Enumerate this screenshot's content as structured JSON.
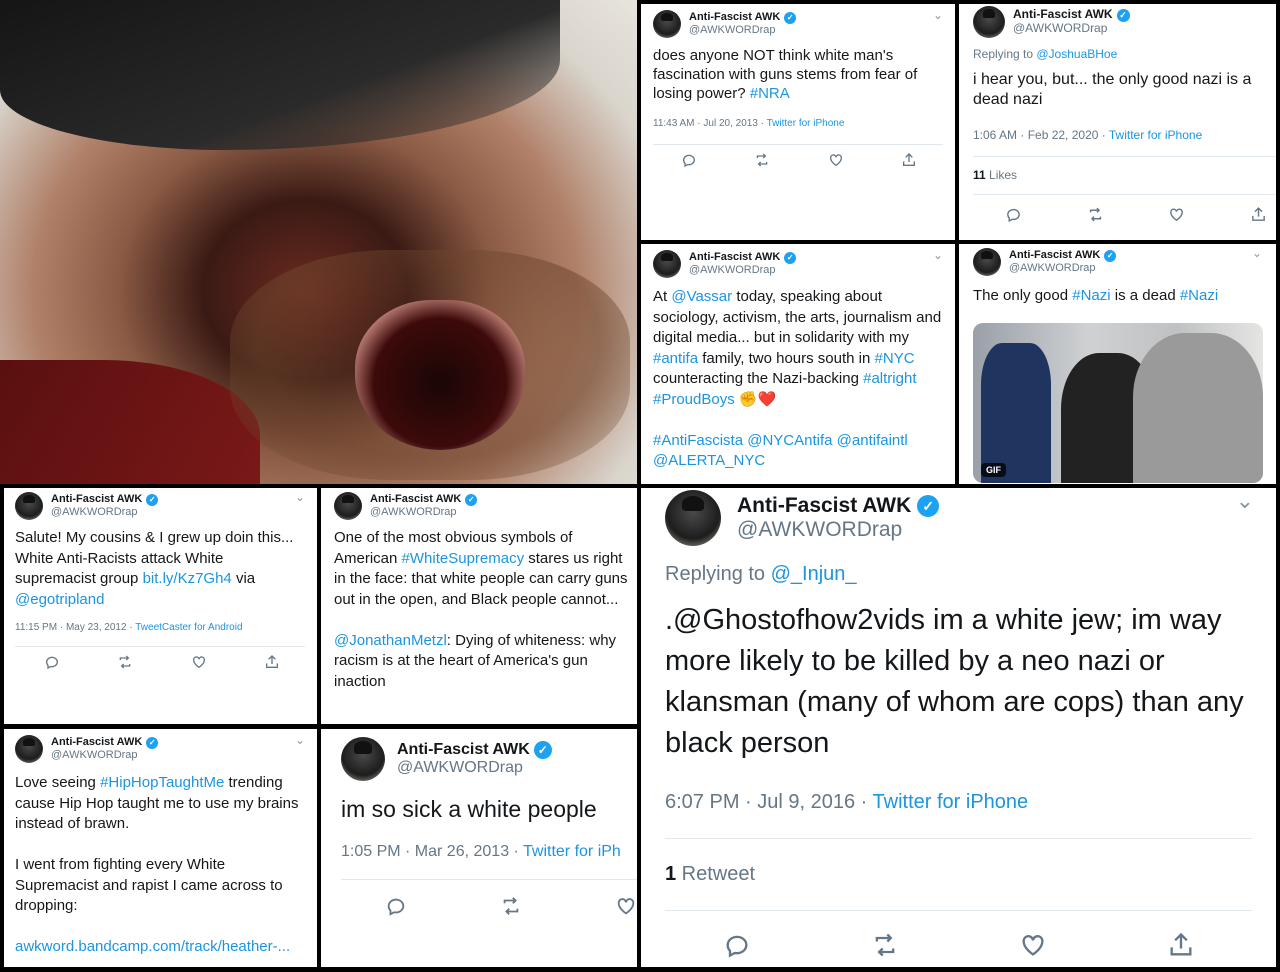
{
  "account": {
    "name": "Anti-Fascist AWK",
    "handle": "@AWKWORDrap"
  },
  "tweets": {
    "t1": {
      "text_parts": [
        "does anyone NOT think white man's fascination with guns stems from fear of losing power? ",
        "#NRA"
      ],
      "time": "11:43 AM · Jul 20, 2013 · ",
      "source": "Twitter for iPhone"
    },
    "t2": {
      "reply_label": "Replying to ",
      "reply_to": "@JoshuaBHoe",
      "text": "i hear you, but... the only good nazi is a dead nazi",
      "time": "1:06 AM · Feb 22, 2020 · ",
      "source": "Twitter for iPhone",
      "likes_count": "11",
      "likes_label": " Likes"
    },
    "t3": {
      "p1": [
        "At ",
        "@Vassar",
        " today, speaking about sociology, activism, the arts, journalism and digital media... but in solidarity with my ",
        "#antifa",
        " family, two hours south in ",
        "#NYC",
        " counteracting the Nazi-backing ",
        "#altright",
        " ",
        "#ProudBoys",
        " ✊❤️"
      ],
      "p2": [
        "#AntiFascista",
        " ",
        "@NYCAntifa",
        " ",
        "@antifaintl",
        " ",
        "@ALERTA_NYC"
      ]
    },
    "t4": {
      "text_parts": [
        "The only good ",
        "#Nazi",
        " is a dead ",
        "#Nazi"
      ],
      "gif_label": "GIF"
    },
    "t5": {
      "text_parts": [
        "Salute! My cousins & I grew up doin this... White Anti-Racists attack White supremacist group ",
        "bit.ly/Kz7Gh4",
        " via ",
        "@egotripland"
      ],
      "time": "11:15 PM · May 23, 2012 · ",
      "source": "TweetCaster for Android"
    },
    "t6": {
      "p1": [
        "One of the most obvious symbols of American ",
        "#WhiteSupremacy",
        " stares us right in the face: that white people can carry guns out in the open, and Black people cannot..."
      ],
      "p2": [
        "@JonathanMetzl",
        ": Dying of whiteness: why racism is at the heart of America's gun inaction"
      ]
    },
    "t7": {
      "p1": [
        "Love seeing ",
        "#HipHopTaughtMe",
        " trending cause Hip Hop taught me to use my brains instead of brawn."
      ],
      "p2": "I went from fighting every White Supremacist and rapist I came across to dropping:",
      "p3": "awkword.bandcamp.com/track/heather-..."
    },
    "t8": {
      "text": "im so sick a white people",
      "time": "1:05 PM · Mar 26, 2013 · ",
      "source": "Twitter for iPh"
    },
    "t9": {
      "reply_label": "Replying to ",
      "reply_to": "@_Injun_",
      "text": ".@Ghostofhow2vids im a white jew; im way more likely to be killed by a neo nazi or klansman (many of whom are cops) than any black person",
      "time": "6:07 PM · Jul 9, 2016 · ",
      "source": "Twitter for iPhone",
      "retweets_count": "1",
      "retweets_label": " Retweet"
    }
  },
  "icons": [
    "reply-icon",
    "retweet-icon",
    "like-icon",
    "share-icon",
    "verified-badge-icon",
    "chevron-down-icon"
  ],
  "colors": {
    "link": "#1b95e0",
    "verified": "#1da1f2",
    "muted": "#657786",
    "background": "#000000"
  }
}
